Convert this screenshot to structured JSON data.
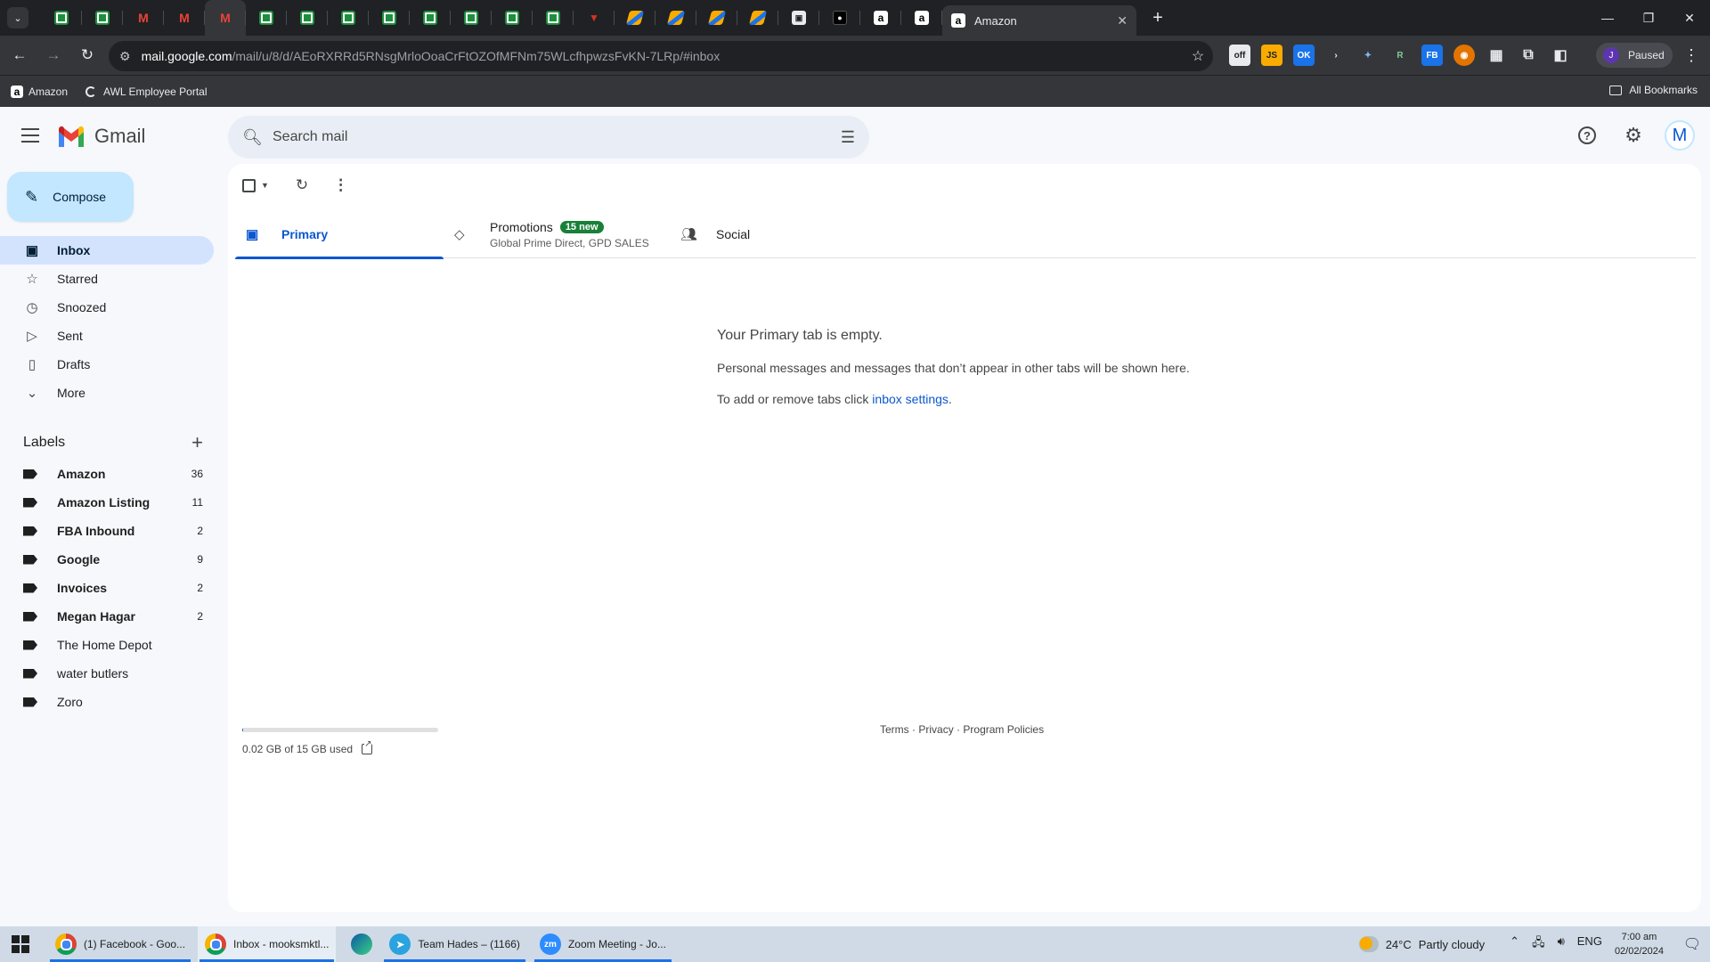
{
  "browser": {
    "pinned_tabs": [
      "sheets",
      "sheets",
      "gmail",
      "gmail",
      "gmail",
      "sheets",
      "sheets",
      "sheets",
      "sheets",
      "sheets",
      "sheets",
      "sheets",
      "sheets",
      "red",
      "stripe",
      "stripe",
      "stripe",
      "stripe",
      "img",
      "dark",
      "amazon",
      "amazon"
    ],
    "active_tab_title": "Amazon",
    "url_host": "mail.google.com",
    "url_path": "/mail/u/8/d/AEoRXRRd5RNsgMrloOoaCrFtOZOfMFNm75WLcfhpwzsFvKN-7LRp/#inbox",
    "profile_initial": "J",
    "profile_status": "Paused",
    "bookmarks": [
      "Amazon",
      "AWL Employee Portal"
    ],
    "all_bookmarks": "All Bookmarks"
  },
  "gmail": {
    "logo_text": "Gmail",
    "search_placeholder": "Search mail",
    "account_initial": "M",
    "compose_label": "Compose",
    "nav": [
      {
        "label": "Inbox",
        "icon": "inbox-icon",
        "active": true
      },
      {
        "label": "Starred",
        "icon": "star-icon"
      },
      {
        "label": "Snoozed",
        "icon": "clock-icon"
      },
      {
        "label": "Sent",
        "icon": "send-icon"
      },
      {
        "label": "Drafts",
        "icon": "draft-icon"
      },
      {
        "label": "More",
        "icon": "chevron-down-icon"
      }
    ],
    "labels_heading": "Labels",
    "labels": [
      {
        "name": "Amazon",
        "count": "36",
        "bold": true
      },
      {
        "name": "Amazon Listing",
        "count": "11",
        "bold": true
      },
      {
        "name": "FBA Inbound",
        "count": "2",
        "bold": true
      },
      {
        "name": "Google",
        "count": "9",
        "bold": true
      },
      {
        "name": "Invoices",
        "count": "2",
        "bold": true
      },
      {
        "name": "Megan Hagar",
        "count": "2",
        "bold": true
      },
      {
        "name": "The Home Depot",
        "count": "",
        "bold": false
      },
      {
        "name": "water butlers",
        "count": "",
        "bold": false
      },
      {
        "name": "Zoro",
        "count": "",
        "bold": false
      }
    ],
    "tabs": {
      "primary": "Primary",
      "promotions": "Promotions",
      "promotions_badge": "15 new",
      "promotions_sub": "Global Prime Direct, GPD SALES",
      "social": "Social"
    },
    "empty": {
      "title": "Your Primary tab is empty.",
      "line1": "Personal messages and messages that don’t appear in other tabs will be shown here.",
      "line2_prefix": "To add or remove tabs click ",
      "line2_link": "inbox settings",
      "line2_suffix": "."
    },
    "storage_text": "0.02 GB of 15 GB used",
    "storage_fraction": 0.0013,
    "footer": [
      "Terms",
      "Privacy",
      "Program Policies"
    ]
  },
  "taskbar": {
    "apps": [
      {
        "label": "(1) Facebook - Goo...",
        "icon": "chrome-icon"
      },
      {
        "label": "Inbox - mooksmktl...",
        "icon": "chrome-icon",
        "active": true
      },
      {
        "label": "",
        "icon": "edge-icon"
      },
      {
        "label": "Team Hades – (1166)",
        "icon": "telegram-icon"
      },
      {
        "label": "Zoom Meeting - Jo...",
        "icon": "zoom-icon"
      }
    ],
    "weather_temp": "24°C",
    "weather_desc": "Partly cloudy",
    "lang": "ENG",
    "time": "7:00 am",
    "date": "02/02/2024"
  }
}
